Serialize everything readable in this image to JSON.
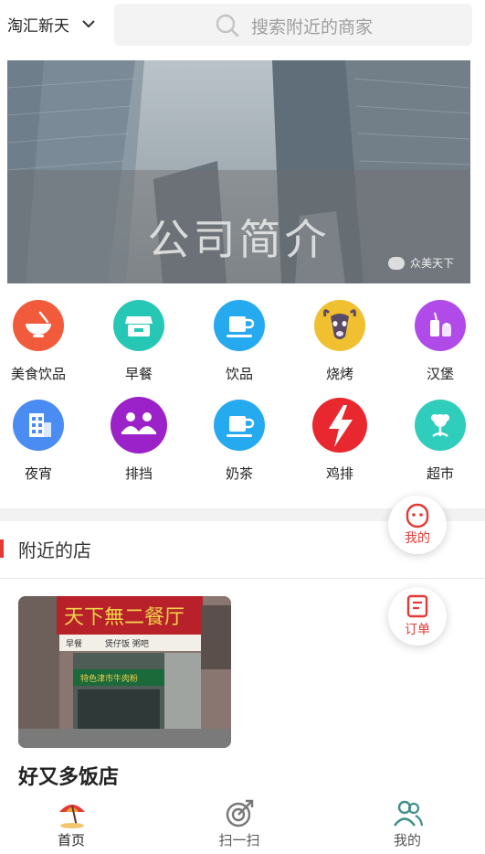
{
  "header": {
    "location": "淘汇新天",
    "search_placeholder": "搜索附近的商家"
  },
  "banner": {
    "title": "公司简介",
    "watermark": "众美天下"
  },
  "categories": [
    {
      "label": "美食饮品",
      "icon": "rice-bowl-icon",
      "color": "#f25a3c"
    },
    {
      "label": "早餐",
      "icon": "shop-icon",
      "color": "#27c7b5"
    },
    {
      "label": "饮品",
      "icon": "cup-icon",
      "color": "#25a9ef"
    },
    {
      "label": "烧烤",
      "icon": "goat-icon",
      "color": "#f0c030"
    },
    {
      "label": "汉堡",
      "icon": "burger-drink-icon",
      "color": "#b04bea"
    },
    {
      "label": "夜宵",
      "icon": "building-icon",
      "color": "#4a8cf2"
    },
    {
      "label": "排挡",
      "icon": "group-icon",
      "color": "#9a22c8"
    },
    {
      "label": "奶茶",
      "icon": "cup-icon",
      "color": "#25a9ef"
    },
    {
      "label": "鸡排",
      "icon": "lightning-icon",
      "color": "#e8282e"
    },
    {
      "label": "超市",
      "icon": "flower-icon",
      "color": "#2fcdbb"
    }
  ],
  "nearby": {
    "title": "附近的店",
    "shops": [
      {
        "name": "好又多饭店",
        "sign": "天下無二餐厅",
        "sign_sub": "煲仔饭  粥吧",
        "sign_side": "早餐",
        "sign_banner": "特色津市牛肉粉"
      }
    ]
  },
  "float_buttons": {
    "mine": "我的",
    "orders": "订单"
  },
  "tabbar": [
    {
      "label": "首页",
      "icon": "beach-umbrella-icon",
      "active": true
    },
    {
      "label": "扫一扫",
      "icon": "scan-target-icon",
      "active": false
    },
    {
      "label": "我的",
      "icon": "users-icon",
      "active": false
    }
  ],
  "colors": {
    "accent": "#e53935",
    "search_bg": "#f3f3f3",
    "divider": "#f2f2f2"
  }
}
